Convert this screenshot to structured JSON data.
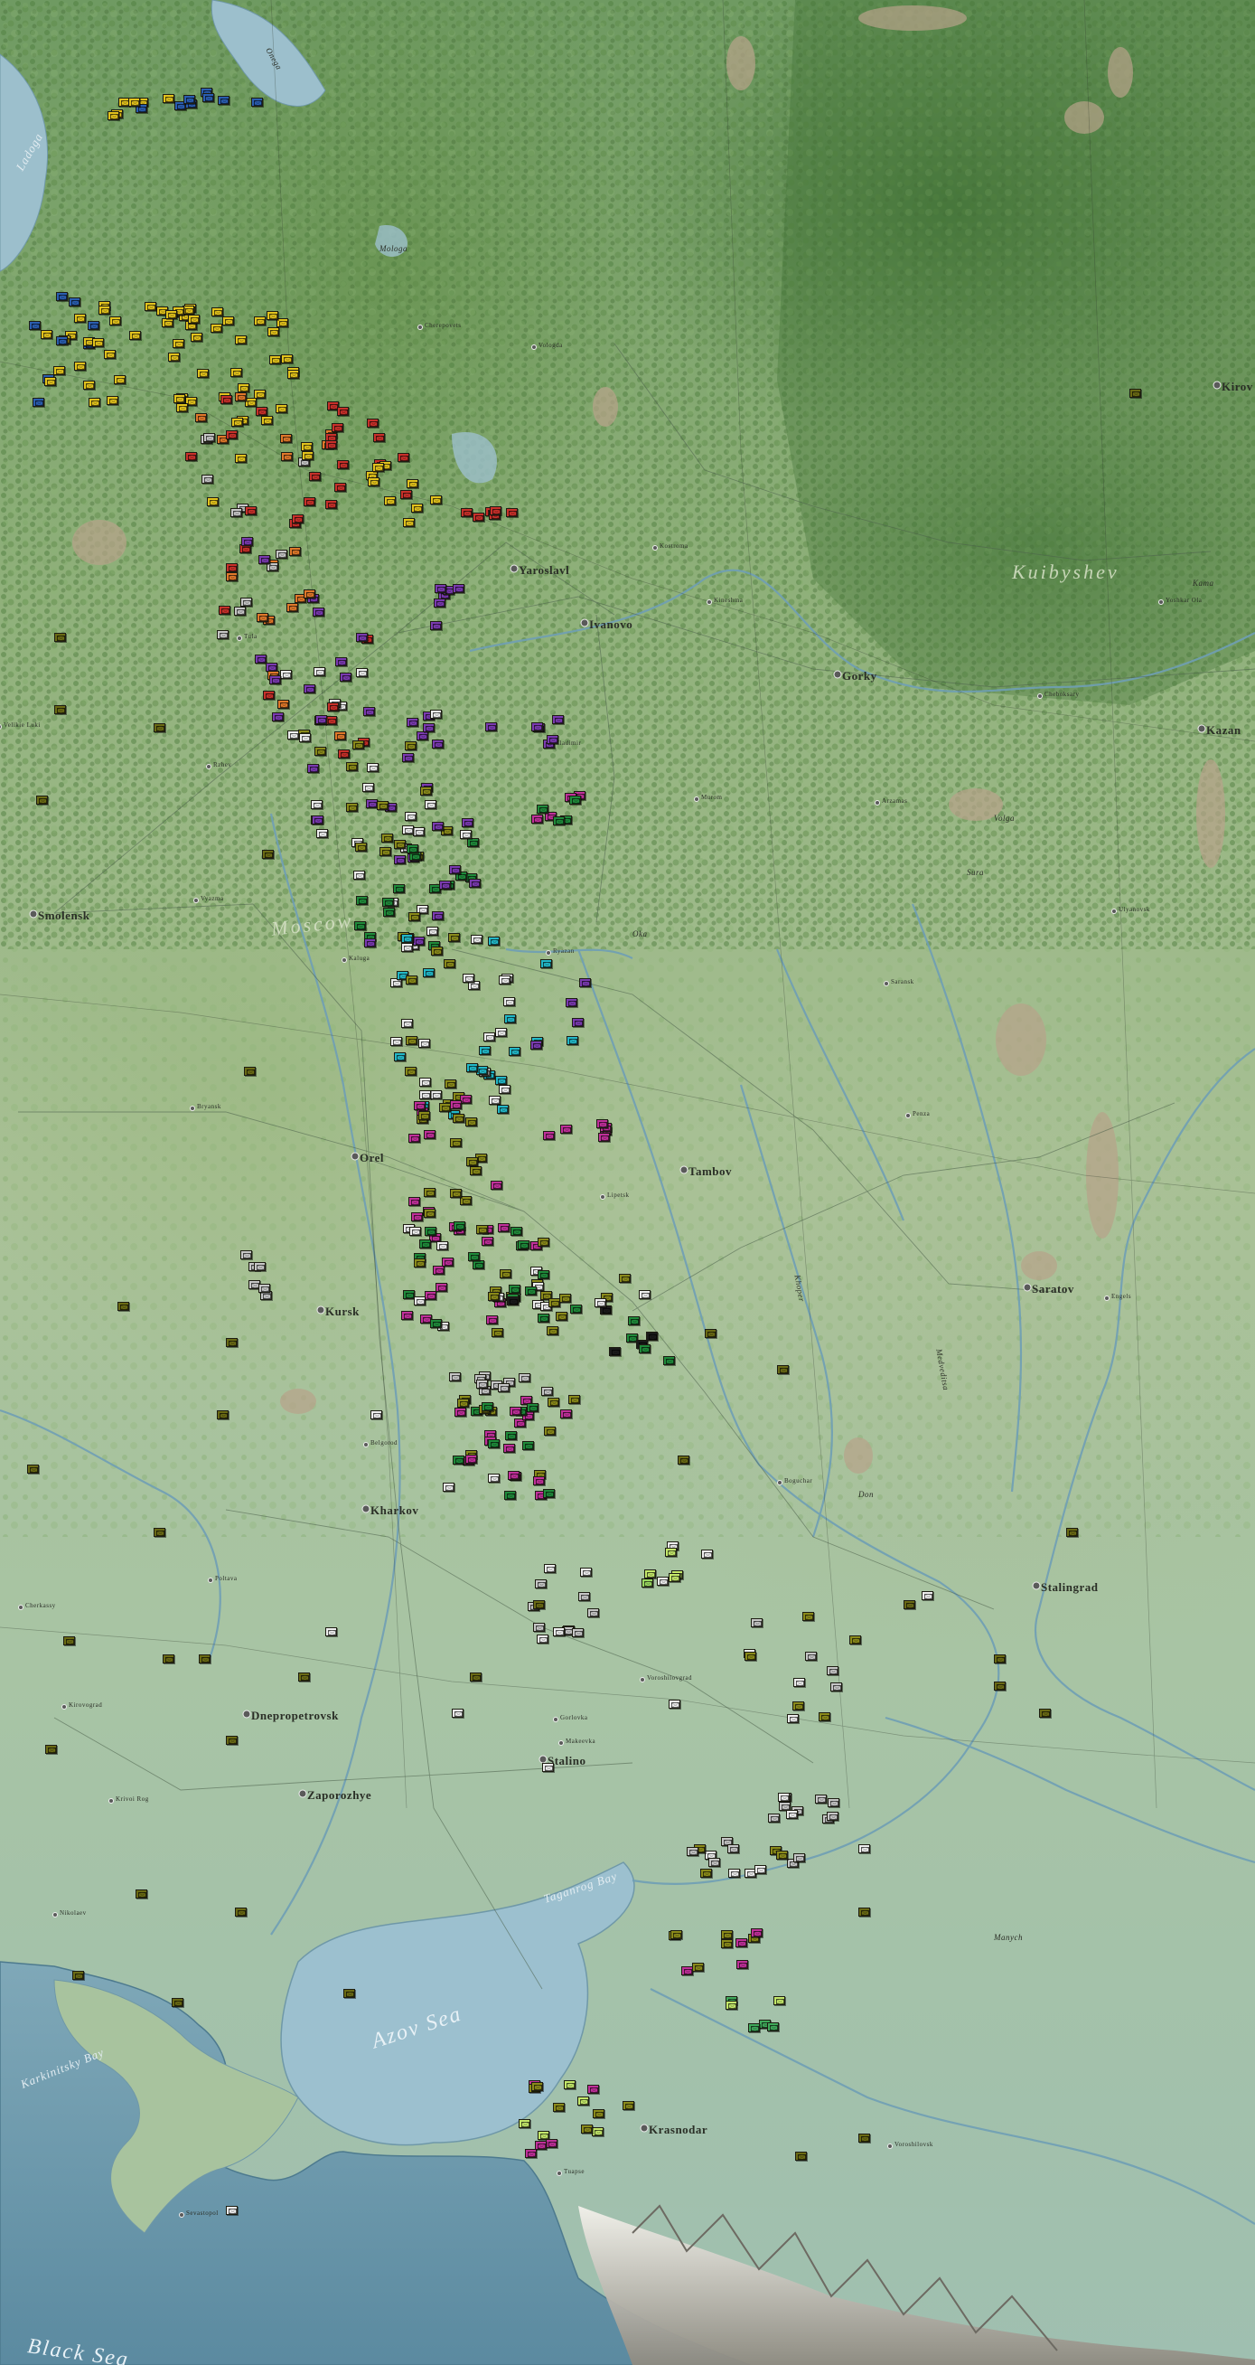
{
  "labels": {
    "cities_major": [
      "Smolensk",
      "Orel",
      "Kursk",
      "Kharkov",
      "Yaroslavl",
      "Ivanovo",
      "Gorky",
      "Tambov",
      "Saratov",
      "Stalingrad",
      "Stalino",
      "Dnepropetrovsk",
      "Zaporozhye",
      "Krasnodar",
      "Kirov",
      "Kazan"
    ],
    "cities_minor": [
      "Cherepovets",
      "Vologda",
      "Kostroma",
      "Kineshma",
      "Vladimir",
      "Murom",
      "Arzamas",
      "Cheboksary",
      "Yoshkar Ola",
      "Ulyanovsk",
      "Saransk",
      "Penza",
      "Ryazan",
      "Kaluga",
      "Vyazma",
      "Bryansk",
      "Lipetsk",
      "Belgorod",
      "Poltava",
      "Kirovograd",
      "Krivoi Rog",
      "Nikolaev",
      "Voroshilovgrad",
      "Gorlovka",
      "Makeevka",
      "Boguchar",
      "Engels",
      "Voroshilovsk",
      "Tuapse",
      "Sevastopol",
      "Cherkassy",
      "Rzhev",
      "Velikie Luki",
      "Tula"
    ],
    "water": [
      "Ladoga",
      "Azov Sea",
      "Karkinitsky Bay",
      "Taganrog Bay",
      "Black Sea",
      "Onega",
      "Volga",
      "Don",
      "Oka",
      "Kama",
      "Sura",
      "Mologa",
      "Khoper",
      "Medveditsa",
      "Manych"
    ],
    "regions": [
      "Moscow",
      "Kuibyshev"
    ]
  },
  "colors": {
    "axis_white": "#eeeeee",
    "axis_gray": "#c6c6c6",
    "finnish_blue": "#2a5db0",
    "romanian_lime": "#c4e86a",
    "hungarian_lime": "#9ad860",
    "italian_green": "#3fa95a",
    "soviet_yellow": "#e2c21c",
    "soviet_orange": "#e0782a",
    "soviet_red": "#c8302a",
    "soviet_purple": "#7a3ab0",
    "soviet_magenta": "#c0309a",
    "soviet_green": "#1f8a3a",
    "soviet_teal": "#22b8c8",
    "soviet_olive": "#8a8a1a",
    "soviet_dark": "#1a1a1a",
    "hq_flag": "#6a6a14"
  },
  "icons": [
    "infantry-counter-icon",
    "armor-counter-icon",
    "hq-flag-icon",
    "city-dot-icon"
  ]
}
